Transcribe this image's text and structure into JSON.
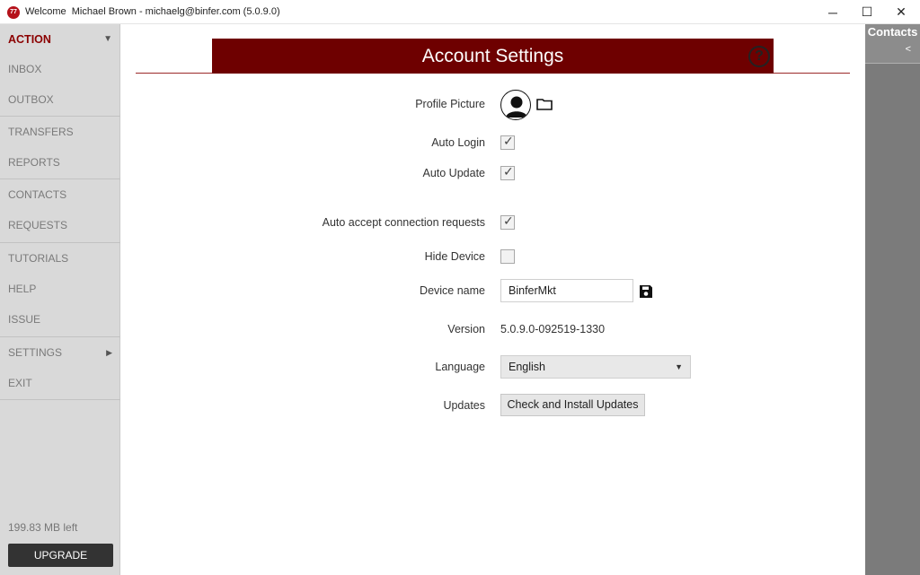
{
  "window": {
    "title": "Welcome  Michael Brown - michaelg@binfer.com (5.0.9.0)",
    "logo_text": "77",
    "controls": {
      "minimize": "─",
      "maximize": "☐",
      "close": "✕"
    }
  },
  "sidebar": {
    "items": [
      {
        "label": "ACTION"
      },
      {
        "label": "INBOX"
      },
      {
        "label": "OUTBOX"
      },
      {
        "label": "TRANSFERS"
      },
      {
        "label": "REPORTS"
      },
      {
        "label": "CONTACTS"
      },
      {
        "label": "REQUESTS"
      },
      {
        "label": "TUTORIALS"
      },
      {
        "label": "HELP"
      },
      {
        "label": "ISSUE"
      },
      {
        "label": "SETTINGS"
      },
      {
        "label": "EXIT"
      }
    ],
    "action_arrow": "▼",
    "settings_arrow": "▶",
    "storage_left": "199.83 MB left",
    "upgrade_label": "UPGRADE"
  },
  "header": {
    "title": "Account Settings",
    "help_glyph": "?"
  },
  "form": {
    "profile_picture_label": "Profile Picture",
    "auto_login_label": "Auto Login",
    "auto_login_checked": true,
    "auto_update_label": "Auto Update",
    "auto_update_checked": true,
    "auto_accept_label": "Auto accept connection requests",
    "auto_accept_checked": true,
    "hide_device_label": "Hide Device",
    "hide_device_checked": false,
    "device_name_label": "Device name",
    "device_name_value": "BinferMkt",
    "version_label": "Version",
    "version_value": "5.0.9.0-092519-1330",
    "language_label": "Language",
    "language_value": "English",
    "updates_label": "Updates",
    "updates_button": "Check and Install Updates",
    "check_glyph": "✓"
  },
  "contacts_panel": {
    "title": "Contacts",
    "collapse_glyph": "<"
  },
  "colors": {
    "brand": "#6e0000",
    "action_text": "#8b0000",
    "sidebar_bg": "#d9d9d9",
    "contacts_bg": "#7b7b7b"
  }
}
